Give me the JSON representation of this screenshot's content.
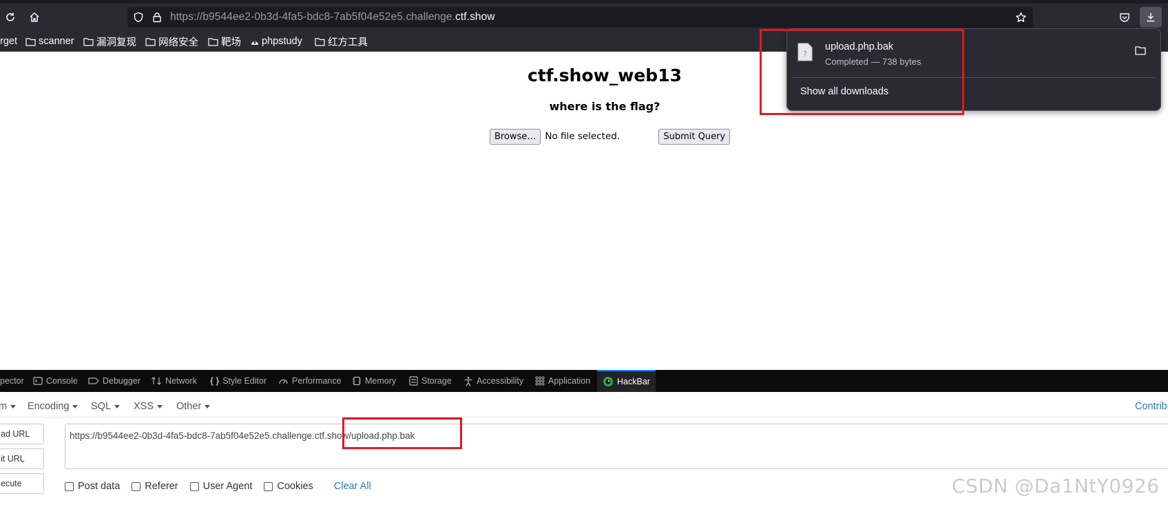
{
  "browser": {
    "url_prefix": "https://b9544ee2-0b3d-4fa5-bdc8-7ab5f04e52e5.challenge.",
    "url_host": "ctf.show",
    "bookmarks": [
      "rget",
      "scanner",
      "漏洞复现",
      "网络安全",
      "靶场",
      "phpstudy",
      "红方工具"
    ]
  },
  "downloads": {
    "file_name": "upload.php.bak",
    "status": "Completed — 738 bytes",
    "show_all_label": "Show all downloads"
  },
  "page": {
    "title": "ctf.show_web13",
    "subtitle": "where is the flag?",
    "browse_label": "Browse…",
    "file_status": "No file selected.",
    "submit_label": "Submit Query"
  },
  "devtools": {
    "tabs": [
      "pector",
      "Console",
      "Debugger",
      "Network",
      "Style Editor",
      "Performance",
      "Memory",
      "Storage",
      "Accessibility",
      "Application",
      "HackBar"
    ],
    "active_tab": "HackBar"
  },
  "hackbar": {
    "menus": [
      "m",
      "Encoding",
      "SQL",
      "XSS",
      "Other"
    ],
    "contribute": "Contribu",
    "side_buttons": [
      "ad URL",
      "it URL",
      "ecute"
    ],
    "url_value": "https://b9544ee2-0b3d-4fa5-bdc8-7ab5f04e52e5.challenge.ctf.show/upload.php.bak",
    "checkboxes": [
      "Post data",
      "Referer",
      "User Agent",
      "Cookies"
    ],
    "clear_all": "Clear All"
  },
  "watermark": "CSDN @Da1NtY0926",
  "colors": {
    "annotation_red": "#e0191e",
    "toolbar_dark": "#2b2a33",
    "link_blue": "#2a7ab0"
  }
}
